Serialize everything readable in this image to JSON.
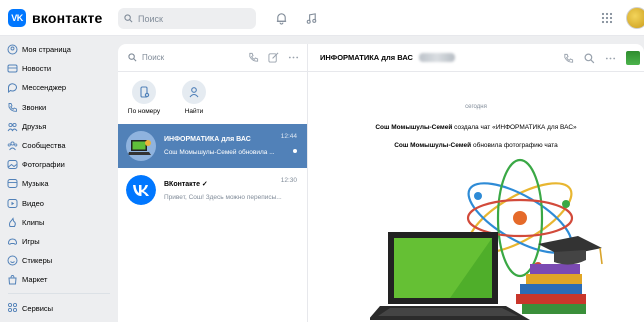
{
  "topbar": {
    "logo_badge": "VK",
    "logo_text": "вконтакте",
    "search_placeholder": "Поиск"
  },
  "nav": {
    "items": [
      {
        "label": "Моя страница",
        "icon": "user-icon"
      },
      {
        "label": "Новости",
        "icon": "news-icon"
      },
      {
        "label": "Мессенджер",
        "icon": "message-icon"
      },
      {
        "label": "Звонки",
        "icon": "phone-icon"
      },
      {
        "label": "Друзья",
        "icon": "friends-icon"
      },
      {
        "label": "Сообщества",
        "icon": "community-icon"
      },
      {
        "label": "Фотографии",
        "icon": "photo-icon"
      },
      {
        "label": "Музыка",
        "icon": "music-icon"
      },
      {
        "label": "Видео",
        "icon": "video-icon"
      },
      {
        "label": "Клипы",
        "icon": "clips-icon"
      },
      {
        "label": "Игры",
        "icon": "games-icon"
      },
      {
        "label": "Стикеры",
        "icon": "stickers-icon"
      },
      {
        "label": "Маркет",
        "icon": "market-icon"
      }
    ],
    "bottom": [
      {
        "label": "Сервисы",
        "icon": "services-icon"
      },
      {
        "label": "VK Pay",
        "icon": "vkpay-icon"
      }
    ]
  },
  "chatlist": {
    "search_placeholder": "Поиск",
    "quick": [
      {
        "label": "По номеру",
        "icon": "phone-add-icon"
      },
      {
        "label": "Найти",
        "icon": "person-search-icon"
      }
    ],
    "chats": [
      {
        "name": "ИНФОРМАТИКА для ВАС",
        "time": "12:44",
        "message": "Сош Момышулы-Семей обновила ...",
        "active": true
      },
      {
        "name": "ВКонтакте ✓",
        "time": "12:30",
        "message": "Привет, Сош! Здесь можно переписы...",
        "active": false
      }
    ]
  },
  "conversation": {
    "title": "ИНФОРМАТИКА для ВАС",
    "date": "сегодня",
    "system1": {
      "actor": "Сош Момышулы-Семей",
      "text": " создала чат «ИНФОРМАТИКА для ВАС»"
    },
    "system2": {
      "actor": "Сош Момышулы-Семей",
      "text": " обновила фотографию чата"
    }
  },
  "colors": {
    "accent": "#0077ff",
    "active_chat": "#5181b8",
    "bg": "#edeef0"
  }
}
